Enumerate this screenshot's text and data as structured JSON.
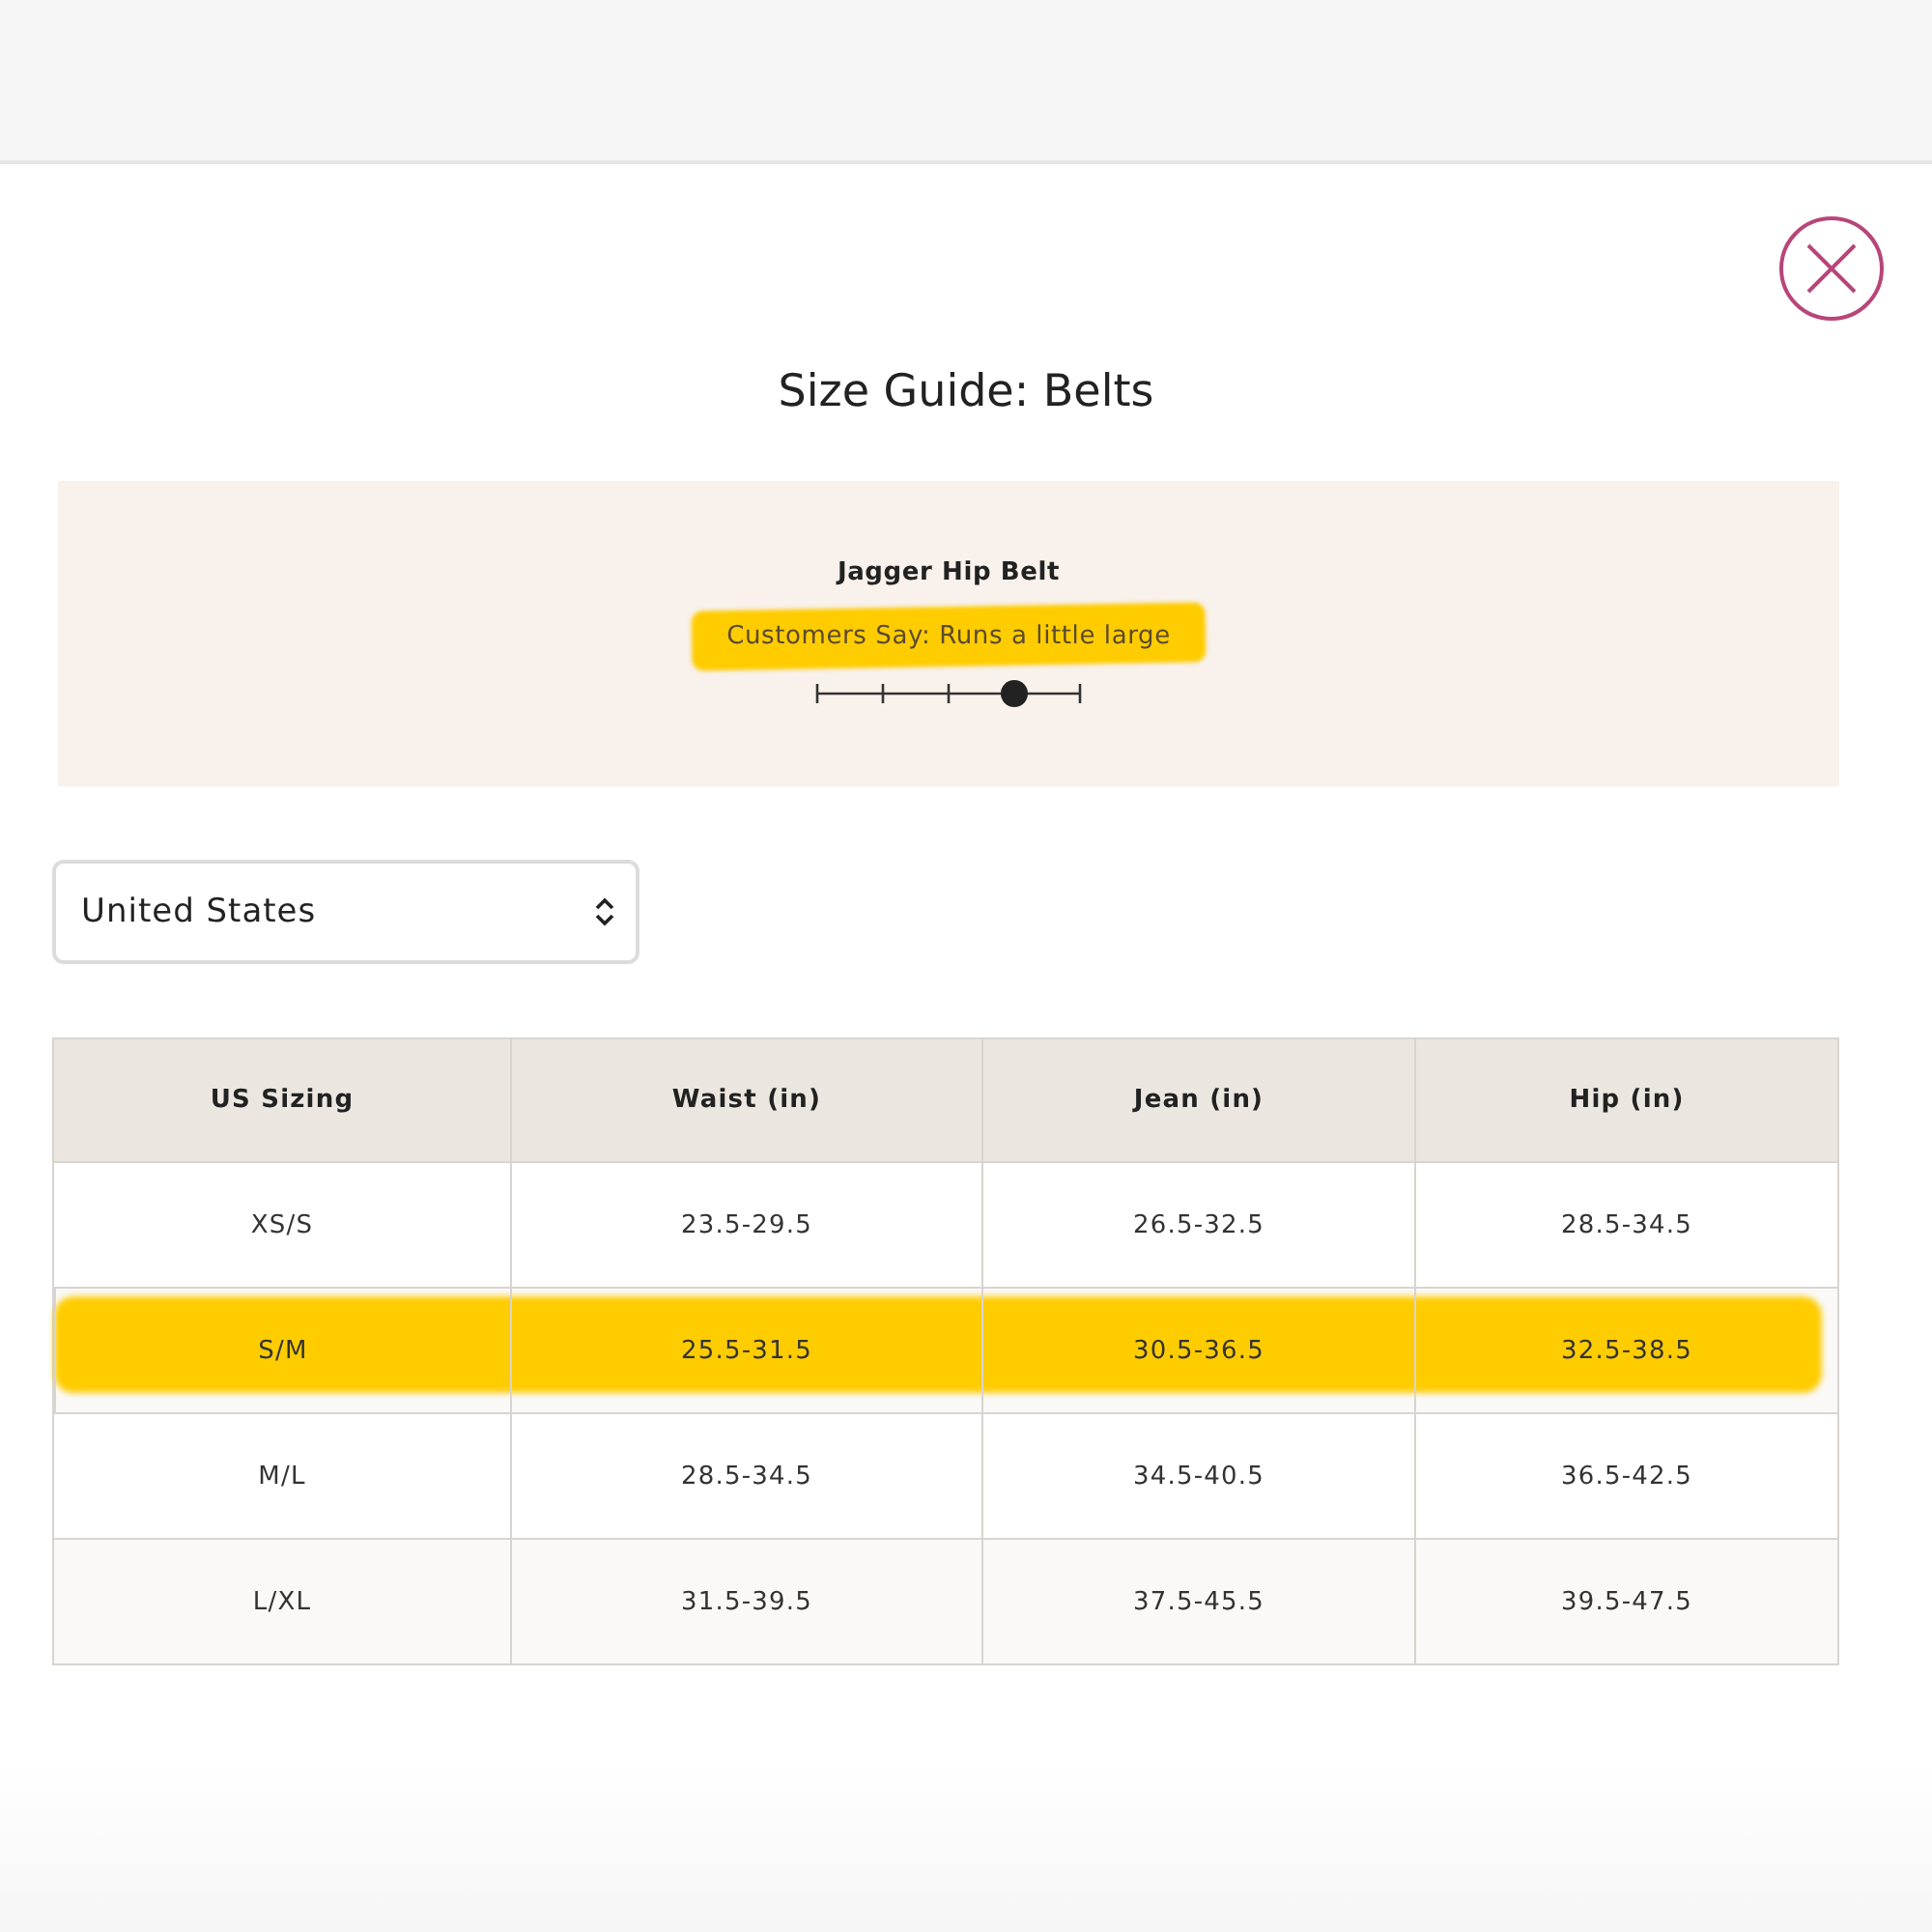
{
  "title": "Size Guide: Belts",
  "fit": {
    "product": "Jagger Hip Belt",
    "summary": "Customers Say: Runs a little large",
    "highlighted": true,
    "level": 0.75
  },
  "region_select": {
    "value": "United States"
  },
  "table": {
    "columns": [
      "US Sizing",
      "Waist (in)",
      "Jean (in)",
      "Hip (in)"
    ],
    "rows": [
      {
        "cells": [
          "XS/S",
          "23.5-29.5",
          "26.5-32.5",
          "28.5-34.5"
        ],
        "highlighted": false
      },
      {
        "cells": [
          "S/M",
          "25.5-31.5",
          "30.5-36.5",
          "32.5-38.5"
        ],
        "highlighted": true
      },
      {
        "cells": [
          "M/L",
          "28.5-34.5",
          "34.5-40.5",
          "36.5-42.5"
        ],
        "highlighted": false
      },
      {
        "cells": [
          "L/XL",
          "31.5-39.5",
          "37.5-45.5",
          "39.5-47.5"
        ],
        "highlighted": false
      }
    ]
  }
}
